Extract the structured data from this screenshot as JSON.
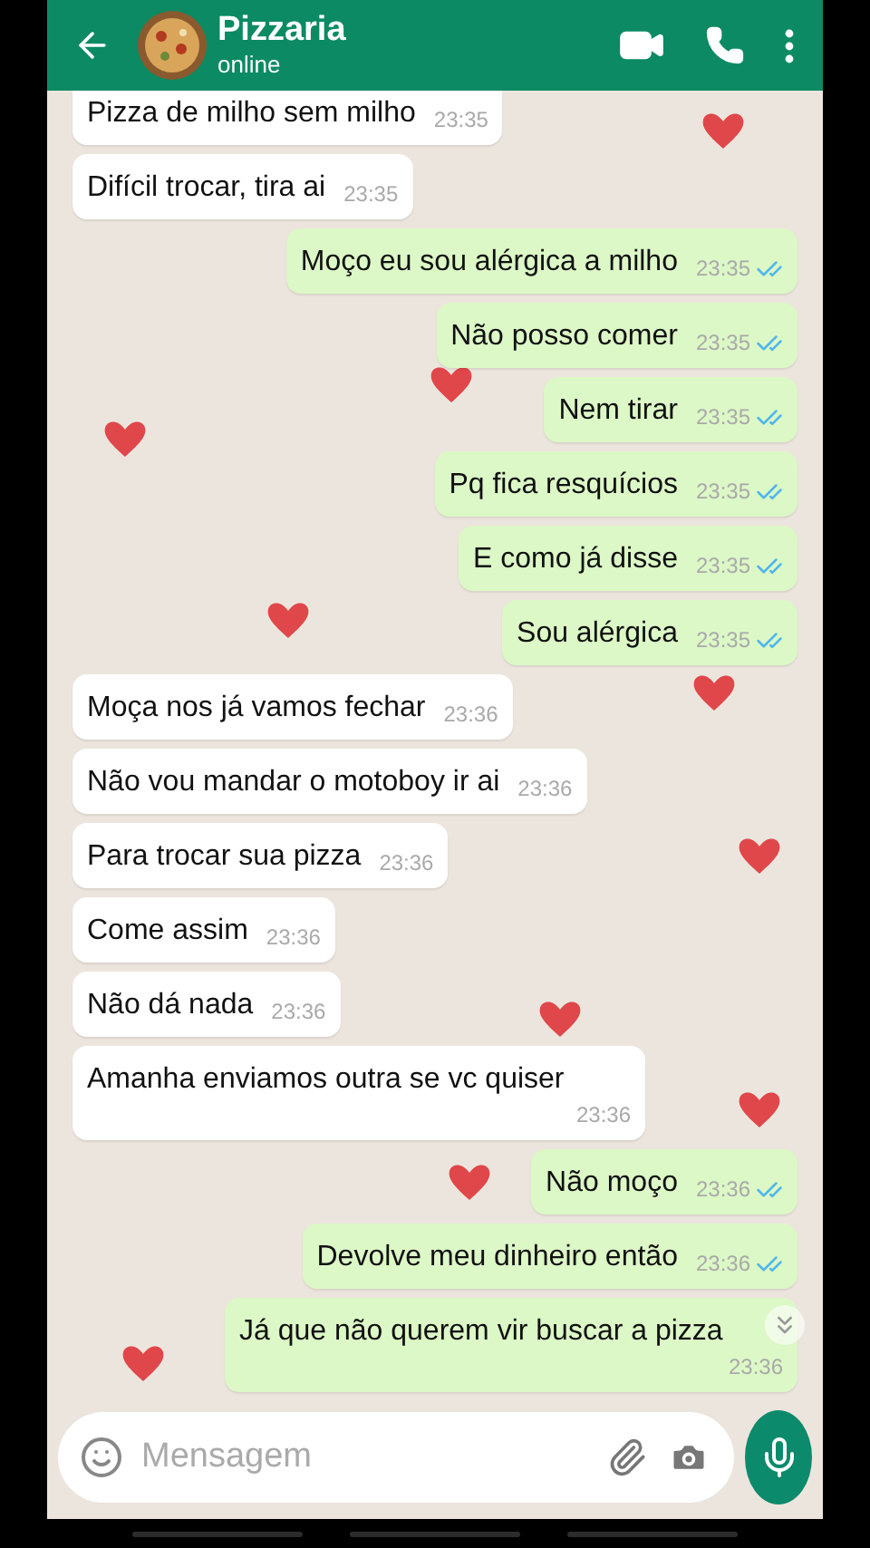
{
  "header": {
    "contact": "Pizzaria",
    "status": "online"
  },
  "messages": [
    {
      "kind": "incoming",
      "text": "Pizza de milho sem milho",
      "time": "23:35"
    },
    {
      "kind": "incoming",
      "text": "Difícil trocar, tira ai",
      "time": "23:35"
    },
    {
      "kind": "outgoing",
      "text": "Moço eu sou alérgica a milho",
      "time": "23:35",
      "read": true
    },
    {
      "kind": "outgoing",
      "text": "Não posso comer",
      "time": "23:35",
      "read": true
    },
    {
      "kind": "outgoing",
      "text": "Nem tirar",
      "time": "23:35",
      "read": true
    },
    {
      "kind": "outgoing",
      "text": "Pq fica resquícios",
      "time": "23:35",
      "read": true
    },
    {
      "kind": "outgoing",
      "text": "E como já disse",
      "time": "23:35",
      "read": true
    },
    {
      "kind": "outgoing",
      "text": "Sou alérgica",
      "time": "23:35",
      "read": true
    },
    {
      "kind": "incoming",
      "text": "Moça nos já vamos fechar",
      "time": "23:36"
    },
    {
      "kind": "incoming",
      "text": "Não vou mandar o motoboy ir ai",
      "time": "23:36"
    },
    {
      "kind": "incoming",
      "text": "Para trocar sua pizza",
      "time": "23:36"
    },
    {
      "kind": "incoming",
      "text": "Come assim",
      "time": "23:36"
    },
    {
      "kind": "incoming",
      "text": "Não dá nada",
      "time": "23:36"
    },
    {
      "kind": "incoming",
      "text": "Amanha enviamos outra se vc quiser",
      "time": "23:36"
    },
    {
      "kind": "outgoing",
      "text": "Não moço",
      "time": "23:36",
      "read": true
    },
    {
      "kind": "outgoing",
      "text": "Devolve meu dinheiro então",
      "time": "23:36",
      "read": true
    },
    {
      "kind": "outgoing",
      "text": "Já que não querem vir buscar a pizza",
      "time": "23:36"
    }
  ],
  "composer": {
    "placeholder": "Mensagem"
  }
}
